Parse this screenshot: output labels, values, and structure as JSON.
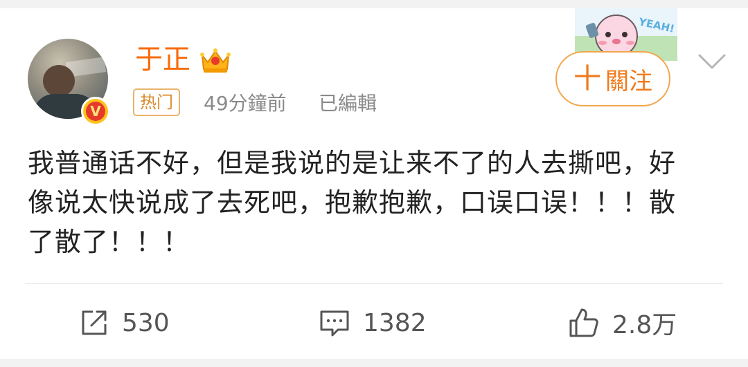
{
  "post": {
    "username": "于正",
    "tag": "热门",
    "time": "49分鐘前",
    "edited": "已編輯",
    "content": "我普通话不好，但是我说的是让来不了的人去撕吧，好像说太快说成了去死吧，抱歉抱歉，口误口误！！！散了散了！！！",
    "sticker_text": "YEAH!"
  },
  "actions": {
    "follow_plus": "十",
    "follow_label": "關注",
    "repost_count": "530",
    "comment_count": "1382",
    "like_count": "2.8万"
  },
  "badge": {
    "verified": "V"
  },
  "colors": {
    "accent": "#f86b0a",
    "follow_border": "#f3a64a",
    "meta": "#8a8a8a"
  }
}
